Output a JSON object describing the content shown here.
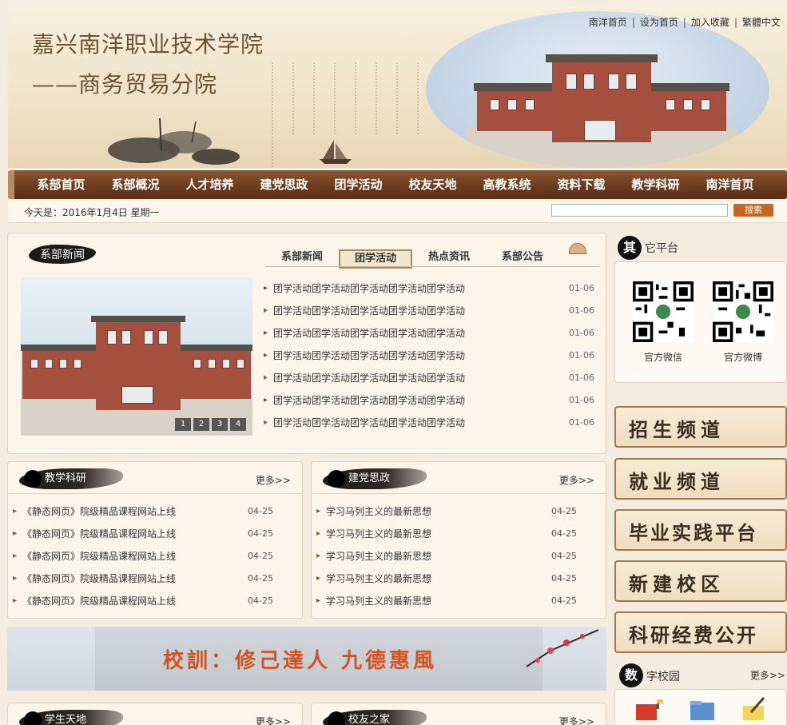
{
  "header": {
    "title": "嘉兴南洋职业技术学院",
    "subtitle": "——商务贸易分院",
    "top_links": [
      "南洋首页",
      "设为首页",
      "加入收藏",
      "繁體中文"
    ]
  },
  "nav": {
    "items": [
      "系部首页",
      "系部概况",
      "人才培养",
      "建党思政",
      "团学活动",
      "校友天地",
      "高教系统",
      "资料下载",
      "教学科研",
      "南洋首页"
    ]
  },
  "datebar": {
    "date": "今天是：2016年1月4日  星期一",
    "search_label": "搜索"
  },
  "news": {
    "title": "系部新闻",
    "tabs": [
      "系部新闻",
      "团学活动",
      "热点资讯",
      "系部公告"
    ],
    "active_tab": "团学活动",
    "slide_dots": [
      "1",
      "2",
      "3",
      "4"
    ],
    "items": [
      {
        "text": "团学活动团学活动团学活动团学活动团学活动",
        "date": "01-06"
      },
      {
        "text": "团学活动团学活动团学活动团学活动团学活动",
        "date": "01-06"
      },
      {
        "text": "团学活动团学活动团学活动团学活动团学活动",
        "date": "01-06"
      },
      {
        "text": "团学活动团学活动团学活动团学活动团学活动",
        "date": "01-06"
      },
      {
        "text": "团学活动团学活动团学活动团学活动团学活动",
        "date": "01-06"
      },
      {
        "text": "团学活动团学活动团学活动团学活动团学活动",
        "date": "01-06"
      },
      {
        "text": "团学活动团学活动团学活动团学活动团学活动",
        "date": "01-06"
      }
    ]
  },
  "teaching": {
    "title": "教学科研",
    "more": "更多>>",
    "items": [
      {
        "text": "《静态网页》院级精品课程网站上线",
        "date": "04-25"
      },
      {
        "text": "《静态网页》院级精品课程网站上线",
        "date": "04-25"
      },
      {
        "text": "《静态网页》院级精品课程网站上线",
        "date": "04-25"
      },
      {
        "text": "《静态网页》院级精品课程网站上线",
        "date": "04-25"
      },
      {
        "text": "《静态网页》院级精品课程网站上线",
        "date": "04-25"
      }
    ]
  },
  "party": {
    "title": "建党思政",
    "more": "更多>>",
    "items": [
      {
        "text": "学习马列主义的最新思想",
        "date": "04-25"
      },
      {
        "text": "学习马列主义的最新思想",
        "date": "04-25"
      },
      {
        "text": "学习马列主义的最新思想",
        "date": "04-25"
      },
      {
        "text": "学习马列主义的最新思想",
        "date": "04-25"
      },
      {
        "text": "学习马列主义的最新思想",
        "date": "04-25"
      }
    ]
  },
  "motto": {
    "text": "校訓：修己達人  九德惠風"
  },
  "student": {
    "title": "学生天地",
    "more": "更多>>"
  },
  "alumni": {
    "title": "校友之家",
    "more": "更多>>"
  },
  "platform": {
    "char": "其",
    "label": "它平台",
    "qr": [
      {
        "caption": "官方微信"
      },
      {
        "caption": "官方微博"
      }
    ]
  },
  "channels": [
    "招生频道",
    "就业频道",
    "毕业实践平台",
    "新建校区",
    "科研经费公开"
  ],
  "digital": {
    "char": "数",
    "label": "字校园",
    "more": "更多>>"
  },
  "colors": {
    "nav_bg": "#6a3a1d",
    "accent": "#c9651f",
    "motto": "#d2531f",
    "page_bg": "#f4ecdf"
  }
}
